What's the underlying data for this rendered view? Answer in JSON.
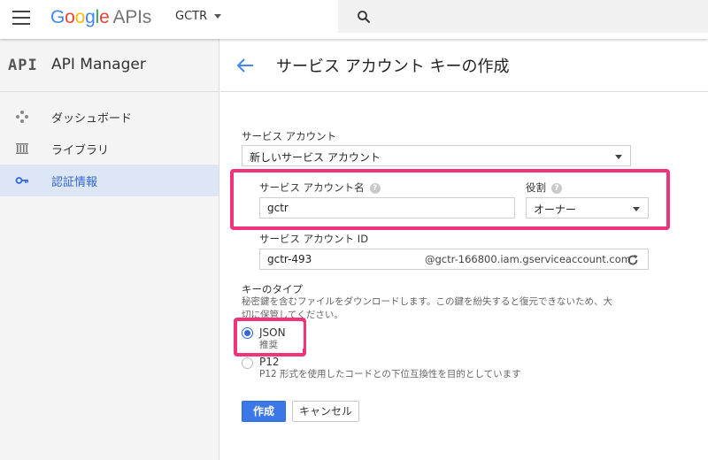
{
  "topbar": {
    "logo_google": "Google",
    "logo_apis": "APIs",
    "project": "GCTR",
    "colors": {
      "blue": "#4285f4",
      "red": "#ea4335",
      "yellow": "#fbbc05",
      "green": "#34a853"
    }
  },
  "sidebar": {
    "api_mark": "API",
    "title": "API Manager",
    "items": [
      {
        "label": "ダッシュボード",
        "icon": "dashboard-icon",
        "active": false
      },
      {
        "label": "ライブラリ",
        "icon": "library-icon",
        "active": false
      },
      {
        "label": "認証情報",
        "icon": "key-icon",
        "active": true
      }
    ]
  },
  "main": {
    "title": "サービス アカウント キーの作成",
    "service_account_label": "サービス アカウント",
    "service_account_value": "新しいサービス アカウント",
    "account_name_label": "サービス アカウント名",
    "account_name_value": "gctr",
    "role_label": "役割",
    "role_value": "オーナー",
    "account_id_label": "サービス アカウント ID",
    "account_id_value": "gctr-493",
    "account_id_domain": "@gctr-166800.iam.gserviceaccount.com",
    "key_type_label": "キーのタイプ",
    "key_type_desc_1": "秘密鍵を含むファイルをダウンロードします。この鍵を紛失すると復元できないため、大",
    "key_type_desc_2": "切に保管してください。",
    "json_label": "JSON",
    "json_sub": "推奨",
    "p12_label": "P12",
    "p12_sub": "P12 形式を使用したコードとの下位互換性を目的としています",
    "create_button": "作成",
    "cancel_button": "キャンセル",
    "selected_key_type": "JSON",
    "accent_color": "#f0337a"
  }
}
